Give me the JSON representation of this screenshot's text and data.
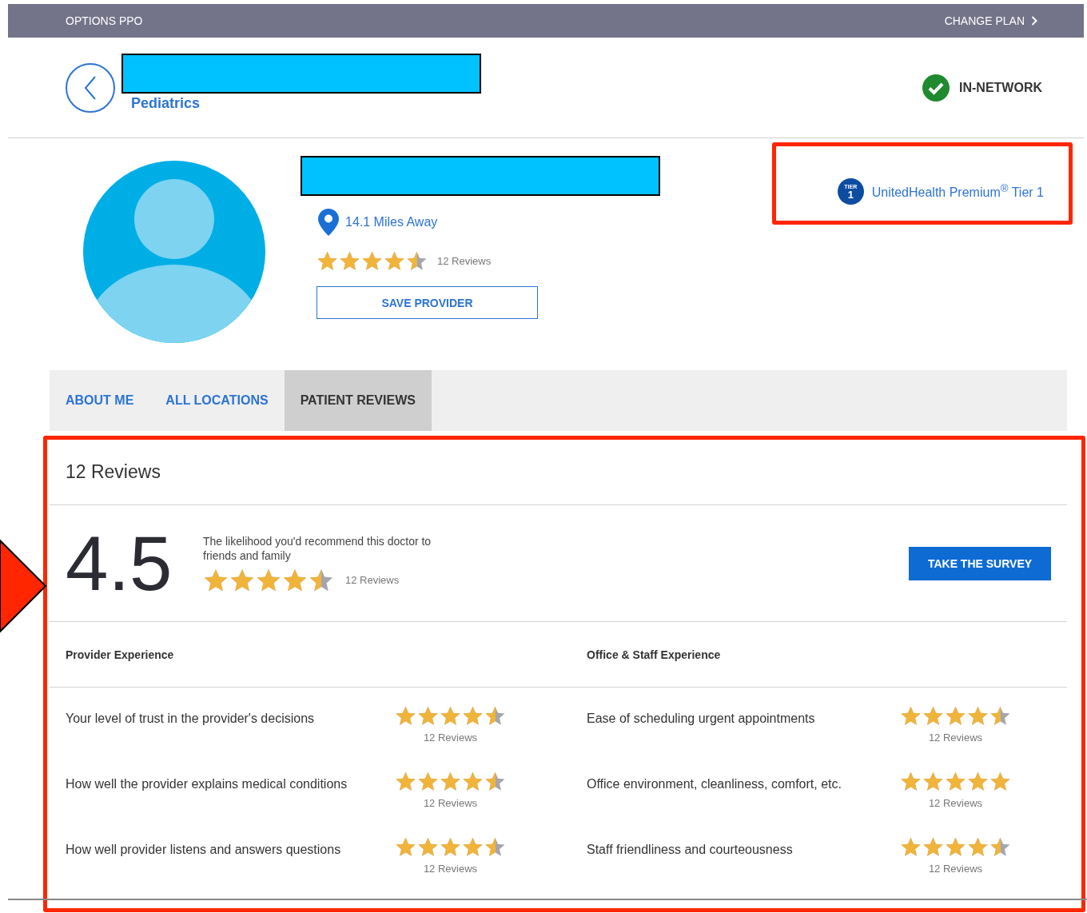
{
  "top_bar": {
    "plan": "OPTIONS PPO",
    "change_plan": "CHANGE PLAN"
  },
  "header": {
    "specialty": "Pediatrics",
    "network_status": "IN-NETWORK"
  },
  "provider": {
    "distance": "14.1 Miles Away",
    "stars": 4.5,
    "review_count": "12 Reviews",
    "save_button": "SAVE PROVIDER",
    "tier": {
      "badge_top": "TIER",
      "badge_number": "1",
      "program": "UnitedHealth Premium$^{®}$ Tier 1"
    }
  },
  "tabs": [
    {
      "label": "ABOUT ME",
      "selected": false
    },
    {
      "label": "ALL LOCATIONS",
      "selected": false
    },
    {
      "label": "PATIENT REVIEWS",
      "selected": true
    }
  ],
  "reviews": {
    "title": "12 Reviews",
    "score": "4.5",
    "question": "The likelihood you'd recommend this doctor to friends and family",
    "stars": 4.5,
    "count": "12 Reviews",
    "survey_button": "TAKE THE SURVEY",
    "columns": [
      {
        "heading": "Provider Experience",
        "items": [
          {
            "label": "Your level of trust in the provider's decisions",
            "stars": 4.5,
            "count": "12 Reviews"
          },
          {
            "label": "How well the provider explains medical conditions",
            "stars": 4.5,
            "count": "12 Reviews"
          },
          {
            "label": "How well provider listens and answers questions",
            "stars": 4.5,
            "count": "12 Reviews"
          }
        ]
      },
      {
        "heading": "Office & Staff Experience",
        "items": [
          {
            "label": "Ease of scheduling urgent appointments",
            "stars": 4.5,
            "count": "12 Reviews"
          },
          {
            "label": "Office environment, cleanliness, comfort, etc.",
            "stars": 5,
            "count": "12 Reviews"
          },
          {
            "label": "Staff friendliness and courteousness",
            "stars": 4.5,
            "count": "12 Reviews"
          }
        ]
      }
    ]
  }
}
